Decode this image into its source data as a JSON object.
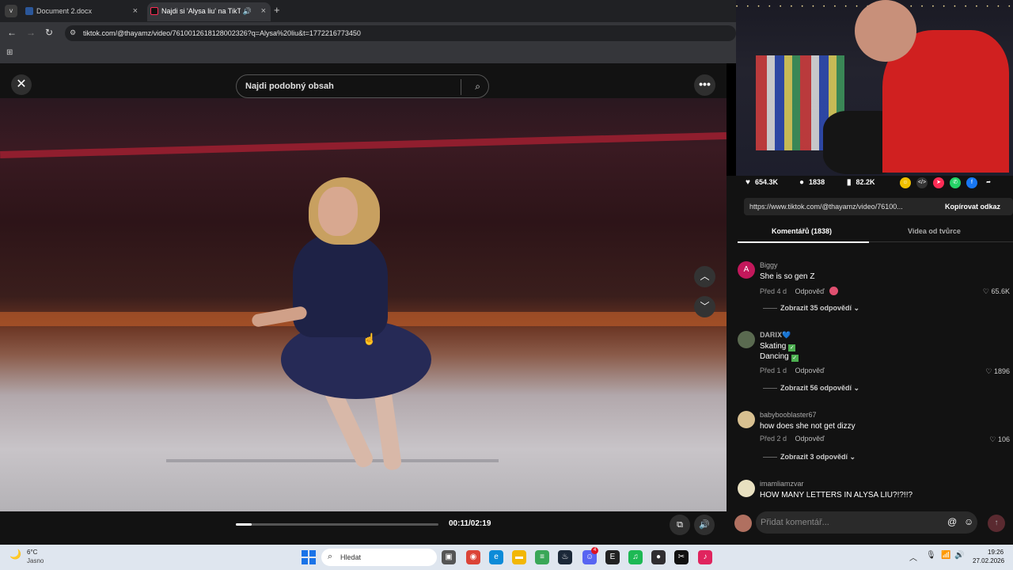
{
  "browser": {
    "tab_menu_icon": "chevron-down-icon",
    "tabs": [
      {
        "title": "Document 2.docx",
        "active": false,
        "color": "#2b579a"
      },
      {
        "title": "Najdi si 'Alysa liu' na TikToku",
        "active": true,
        "color": "#000000"
      }
    ],
    "close_symbol": "×",
    "sound_symbol": "🔊",
    "new_tab_symbol": "+",
    "back_symbol": "←",
    "forward_symbol": "→",
    "reload_symbol": "↻",
    "url": "tiktok.com/@thayamz/video/7610012618128002326?q=Alysa%20liu&t=1772216773450",
    "apps_symbol": "⊞"
  },
  "viewer": {
    "close_symbol": "✕",
    "search_placeholder": "Najdi podobný obsah",
    "search_symbol": "⌕",
    "more_symbol": "•••",
    "nav_up_symbol": "︿",
    "nav_down_symbol": "﹀",
    "cursor_symbol": "☝",
    "progress": 0.079,
    "time": "00:11/02:19",
    "pip_symbol": "⧉",
    "volume_symbol": "🔊"
  },
  "webcam": {
    "lights": "• • • • • • • • • • • • • • • • • • • • • • • • • • • • • • •"
  },
  "panel": {
    "likes": "654.3K",
    "comments_count": "1838",
    "saves": "82.2K",
    "like_symbol": "♥",
    "comment_symbol": "●",
    "save_symbol": "▮",
    "share_buttons": [
      {
        "name": "coin-share-icon",
        "symbol": "☺",
        "color": "#f0c000"
      },
      {
        "name": "embed-icon",
        "symbol": "</>",
        "color": "#333333"
      },
      {
        "name": "send-icon",
        "symbol": "➤",
        "color": "#fe2c55"
      },
      {
        "name": "whatsapp-icon",
        "symbol": "✆",
        "color": "#25d366"
      },
      {
        "name": "facebook-icon",
        "symbol": "f",
        "color": "#1877f2"
      },
      {
        "name": "share-arrow-icon",
        "symbol": "➦",
        "color": "#121212"
      }
    ],
    "link": "https://www.tiktok.com/@thayamz/video/76100...",
    "copy_label": "Kopírovat odkaz",
    "tab_comments": "Komentářů (1838)",
    "tab_creator": "Videa od tvůrce",
    "comments": [
      {
        "user": "Biggy",
        "avatar_letter": "A",
        "avatar_color": "#c2185b",
        "lines": [
          "She is so gen Z"
        ],
        "age": "Před 4 d",
        "reply": "Odpověď",
        "likes": "65.6K",
        "more": "Zobrazit 35 odpovědí"
      },
      {
        "user": "𝐃𝐀𝐑𝐈𝐗💙",
        "avatar_letter": "",
        "avatar_color": "#5a6a50",
        "lines": [
          "Skating",
          "Dancing"
        ],
        "age": "Před 1 d",
        "reply": "Odpověď",
        "likes": "1896",
        "more": "Zobrazit 56 odpovědí"
      },
      {
        "user": "babybooblaster67",
        "avatar_letter": "",
        "avatar_color": "#d8c090",
        "lines": [
          "how does she not get dizzy"
        ],
        "age": "Před 2 d",
        "reply": "Odpověď",
        "likes": "106",
        "more": "Zobrazit 3 odpovědí"
      },
      {
        "user": "imamliamzvar",
        "avatar_letter": "",
        "avatar_color": "#e8e0c0",
        "lines": [
          "HOW MANY LETTERS IN ALYSA LIU?!?!!?"
        ]
      }
    ],
    "heart_symbol": "♡",
    "check_symbol": "✓",
    "chevron_symbol": "⌄",
    "comment_placeholder": "Přidat komentář...",
    "at_symbol": "@",
    "emoji_symbol": "☺",
    "send_symbol": "↑"
  },
  "taskbar": {
    "weather_symbol": "🌙",
    "temp": "6°C",
    "condition": "Jasno",
    "search_symbol": "⌕",
    "search_label": "Hledat",
    "apps": [
      {
        "name": "task-view-icon",
        "symbol": "▣",
        "color": "#555555"
      },
      {
        "name": "chrome-icon",
        "symbol": "◉",
        "color": "#db4437"
      },
      {
        "name": "edge-icon",
        "symbol": "e",
        "color": "#0c8bd8"
      },
      {
        "name": "file-explorer-icon",
        "symbol": "▬",
        "color": "#f2b705"
      },
      {
        "name": "notepad-icon",
        "symbol": "≡",
        "color": "#3aa757"
      },
      {
        "name": "steam-icon",
        "symbol": "♨",
        "color": "#1b2838"
      },
      {
        "name": "discord-icon",
        "symbol": "☺",
        "color": "#5865f2"
      },
      {
        "name": "epic-games-icon",
        "symbol": "E",
        "color": "#222222"
      },
      {
        "name": "spotify-icon",
        "symbol": "♫",
        "color": "#1db954"
      },
      {
        "name": "obs-icon",
        "symbol": "●",
        "color": "#302e31"
      },
      {
        "name": "capcut-icon",
        "symbol": "✂",
        "color": "#111111"
      },
      {
        "name": "tiktok-icon",
        "symbol": "♪",
        "color": "#e0245e"
      }
    ],
    "discord_badge": "4",
    "tray_chevron": "︿",
    "mic_symbol": "🎙",
    "wifi_symbol": "📶",
    "speaker_symbol": "🔊",
    "time": "19:26",
    "date": "27.02.2026"
  }
}
